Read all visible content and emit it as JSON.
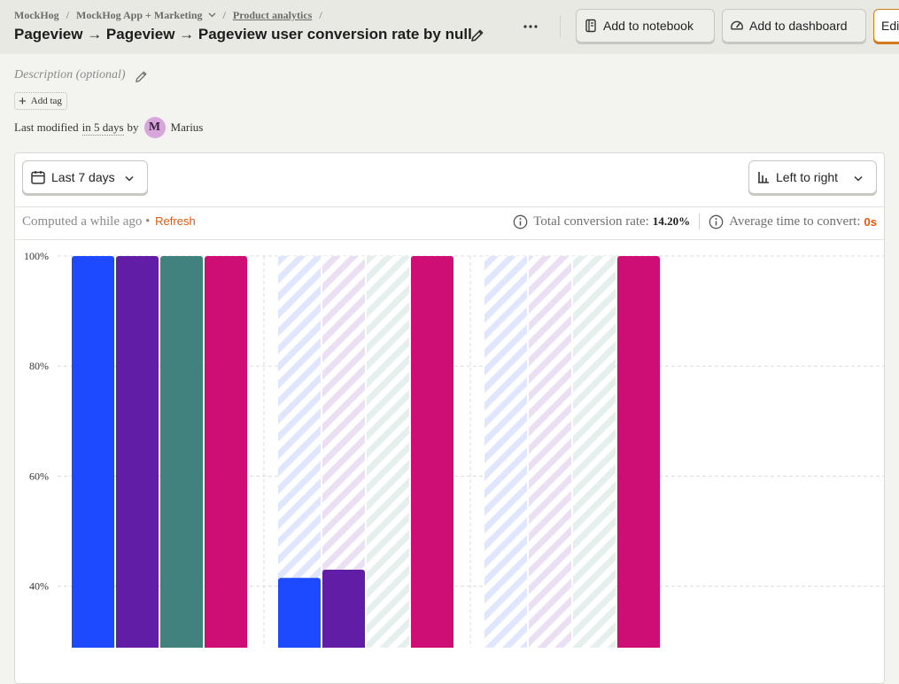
{
  "breadcrumb": {
    "org": "MockHog",
    "project": "MockHog App + Marketing",
    "section": "Product analytics"
  },
  "title": "Pageview → Pageview → Pageview user conversion rate by null",
  "toolbar": {
    "notebook_label": "Add to notebook",
    "dashboard_label": "Add to dashboard",
    "edit_label": "Edit"
  },
  "description_placeholder": "Description (optional)",
  "tag_label": "Add tag",
  "modified": {
    "prefix": "Last modified",
    "when": "in 5 days",
    "by": "by",
    "avatar_letter": "M",
    "user": "Marius"
  },
  "filters": {
    "date_range": "Last 7 days",
    "layout": "Left to right"
  },
  "status": {
    "computed": "Computed a while ago",
    "dot": "•",
    "refresh": "Refresh"
  },
  "stats": {
    "conversion_label": "Total conversion rate:",
    "conversion_value": "14.20%",
    "time_label": "Average time to convert:",
    "time_value": "0s"
  },
  "colors": {
    "series_blue": "#1d4aff",
    "series_purple": "#621da6",
    "series_teal": "#42827e",
    "series_pink": "#ce0e74",
    "accent_orange": "#e0580f"
  },
  "chart_data": {
    "type": "bar",
    "yticks": [
      "100%",
      "80%",
      "60%",
      "40%"
    ],
    "ylim": [
      0,
      100
    ],
    "grid": true,
    "series_colors": [
      "#1d4aff",
      "#621da6",
      "#42827e",
      "#ce0e74"
    ],
    "series_fade": [
      "#e1e6ff",
      "#ebdff3",
      "#e4efee"
    ],
    "groups": [
      {
        "values": [
          100,
          100,
          100,
          100
        ]
      },
      {
        "values": [
          41.5,
          43,
          0,
          100
        ]
      },
      {
        "values": [
          0,
          0,
          0,
          100
        ]
      }
    ]
  }
}
